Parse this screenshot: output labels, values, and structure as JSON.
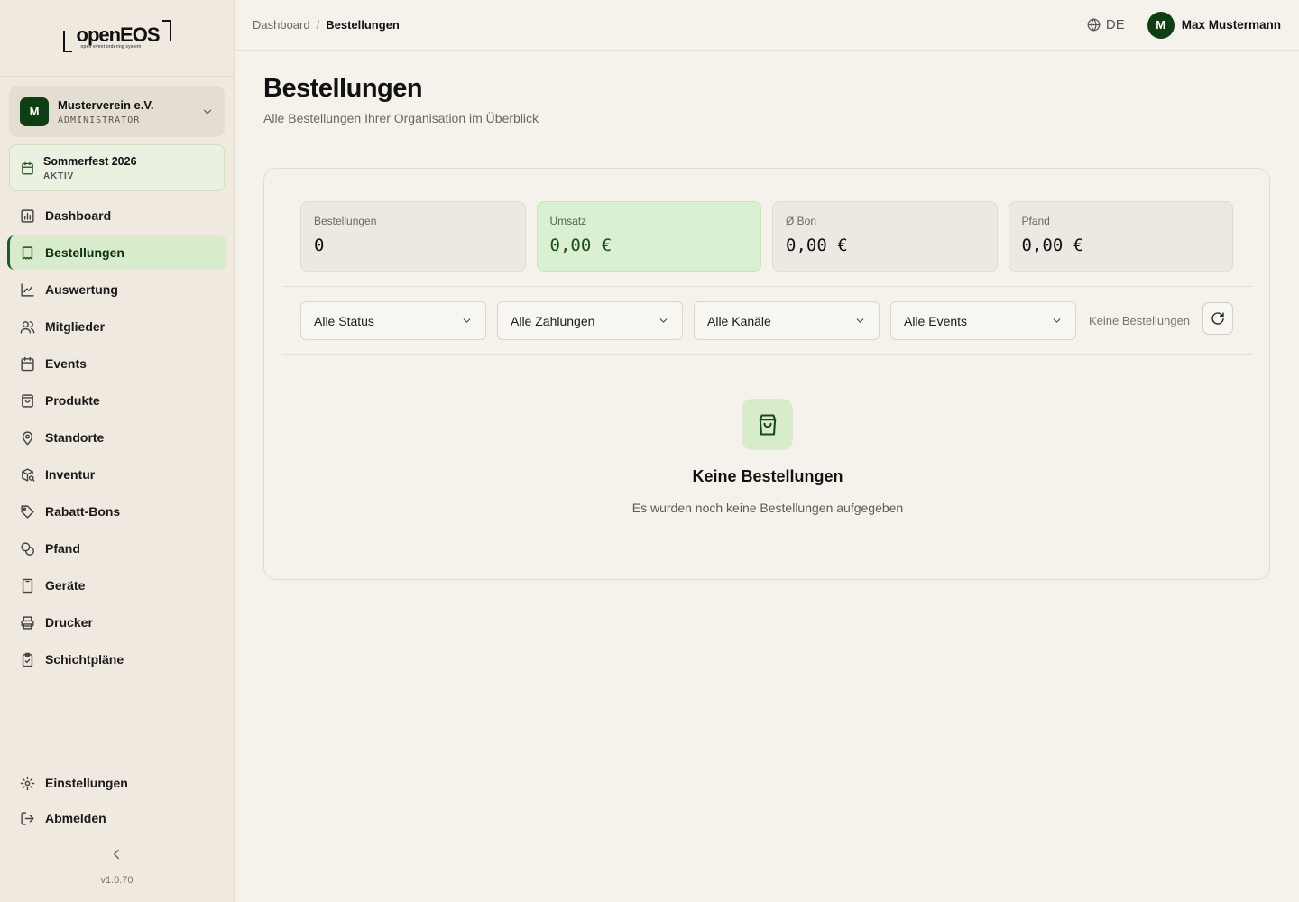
{
  "brand": {
    "name": "openEOS",
    "tagline": "open event ordering system"
  },
  "organization": {
    "avatar_letter": "M",
    "name": "Musterverein e.V.",
    "role": "ADMINISTRATOR"
  },
  "event": {
    "name": "Sommerfest 2026",
    "status": "AKTIV"
  },
  "sidebar": {
    "items": [
      {
        "label": "Dashboard",
        "icon": "dashboard-icon"
      },
      {
        "label": "Bestellungen",
        "icon": "receipt-icon",
        "active": true
      },
      {
        "label": "Auswertung",
        "icon": "line-chart-icon"
      },
      {
        "label": "Mitglieder",
        "icon": "users-icon"
      },
      {
        "label": "Events",
        "icon": "calendar-icon"
      },
      {
        "label": "Produkte",
        "icon": "shopping-bag-icon"
      },
      {
        "label": "Standorte",
        "icon": "map-pin-icon"
      },
      {
        "label": "Inventur",
        "icon": "package-search-icon"
      },
      {
        "label": "Rabatt-Bons",
        "icon": "tag-icon"
      },
      {
        "label": "Pfand",
        "icon": "coins-icon"
      },
      {
        "label": "Geräte",
        "icon": "tablet-icon"
      },
      {
        "label": "Drucker",
        "icon": "printer-icon"
      },
      {
        "label": "Schichtpläne",
        "icon": "clipboard-check-icon"
      }
    ],
    "settings_label": "Einstellungen",
    "logout_label": "Abmelden",
    "version": "v1.0.70"
  },
  "topbar": {
    "breadcrumb_root": "Dashboard",
    "breadcrumb_separator": "/",
    "breadcrumb_current": "Bestellungen",
    "language": "DE",
    "user_avatar_letter": "M",
    "user_name": "Max Mustermann"
  },
  "page": {
    "title": "Bestellungen",
    "subtitle": "Alle Bestellungen Ihrer Organisation im Überblick"
  },
  "stats": [
    {
      "label": "Bestellungen",
      "value": "0"
    },
    {
      "label": "Umsatz",
      "value": "0,00 €",
      "highlight": true
    },
    {
      "label": "Ø Bon",
      "value": "0,00 €"
    },
    {
      "label": "Pfand",
      "value": "0,00 €"
    }
  ],
  "filters": {
    "status": "Alle Status",
    "payment": "Alle Zahlungen",
    "channel": "Alle Kanäle",
    "event": "Alle Events",
    "count_text": "Keine Bestellungen"
  },
  "empty_state": {
    "title": "Keine Bestellungen",
    "text": "Es wurden noch keine Bestellungen aufgegeben"
  },
  "colors": {
    "accent": "#0f3d14",
    "active_bg": "#d8eccc",
    "background": "#f5f2ec",
    "sidebar_bg": "#efe9df"
  }
}
